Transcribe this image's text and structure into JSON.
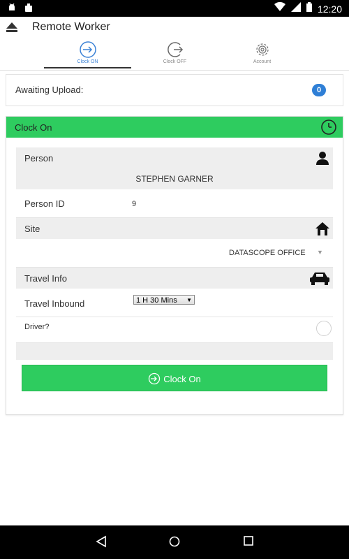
{
  "status_bar": {
    "time": "12:20"
  },
  "app_bar": {
    "title": "Remote Worker"
  },
  "tabs": [
    {
      "label": "Clock ON",
      "icon": "clock-on-icon",
      "active": true
    },
    {
      "label": "Clock OFF",
      "icon": "clock-off-icon",
      "active": false
    },
    {
      "label": "Account",
      "icon": "gear-icon",
      "active": false
    }
  ],
  "upload": {
    "label": "Awaiting Upload:",
    "count": "0"
  },
  "clock_on": {
    "header": "Clock On",
    "person_section": "Person",
    "person_name": "STEPHEN GARNER",
    "person_id_label": "Person ID",
    "person_id": "9",
    "site_section": "Site",
    "site_value": "DATASCOPE OFFICE",
    "travel_section": "Travel Info",
    "travel_inbound_label": "Travel Inbound",
    "travel_inbound_value": "1 H 30 Mins",
    "driver_label": "Driver?",
    "button_label": "Clock On"
  },
  "colors": {
    "accent_green": "#2ecc5f",
    "badge_blue": "#2f7fd6",
    "tab_active": "#3b82d6"
  }
}
